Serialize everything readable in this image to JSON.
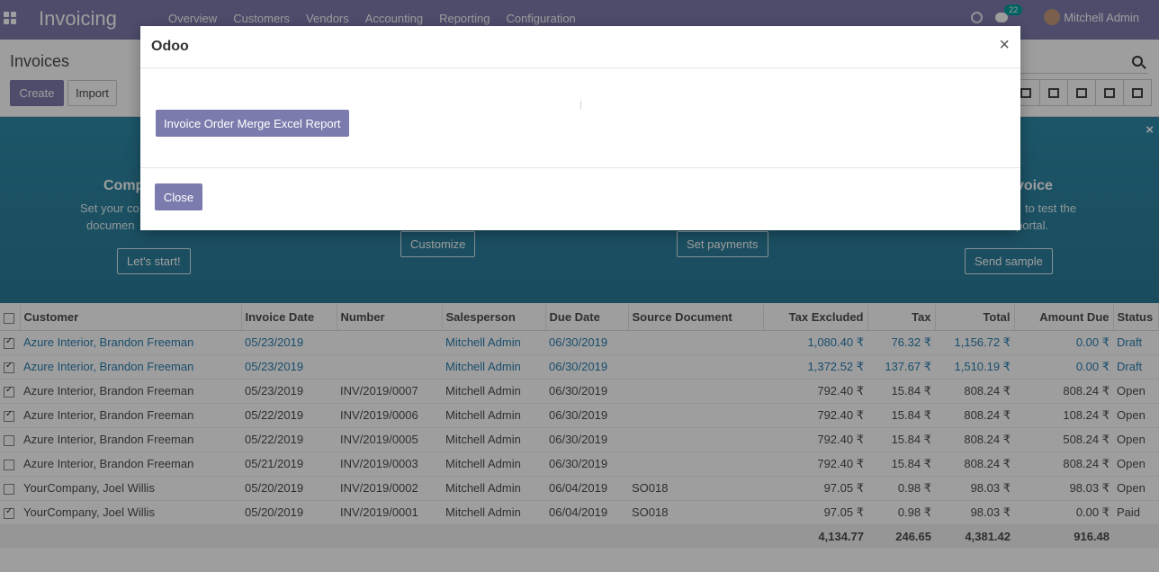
{
  "navbar": {
    "app_name": "Invoicing",
    "menu": [
      "Overview",
      "Customers",
      "Vendors",
      "Accounting",
      "Reporting",
      "Configuration"
    ],
    "chat_count": "22",
    "user": "Mitchell Admin"
  },
  "control_panel": {
    "title": "Invoices",
    "create_label": "Create",
    "import_label": "Import"
  },
  "banner": {
    "steps": [
      {
        "title": "Comp",
        "desc": [
          "Set your co",
          "documen"
        ],
        "button": "Let's start!"
      },
      {
        "title": "",
        "desc": [],
        "button": "Customize"
      },
      {
        "title": "",
        "desc": [],
        "button": "Set payments"
      },
      {
        "title": "voice",
        "desc": [
          "to test the",
          "portal."
        ],
        "button": "Send sample"
      }
    ]
  },
  "table": {
    "headers": [
      "Customer",
      "Invoice Date",
      "Number",
      "Salesperson",
      "Due Date",
      "Source Document",
      "Tax Excluded",
      "Tax",
      "Total",
      "Amount Due",
      "Status"
    ],
    "rows": [
      {
        "checked": true,
        "draft": true,
        "customer": "Azure Interior, Brandon Freeman",
        "date": "05/23/2019",
        "number": "",
        "salesperson": "Mitchell Admin",
        "due": "06/30/2019",
        "source": "",
        "tax_excl": "1,080.40 ₹",
        "tax": "76.32 ₹",
        "total": "1,156.72 ₹",
        "due_amt": "0.00 ₹",
        "status": "Draft"
      },
      {
        "checked": true,
        "draft": true,
        "customer": "Azure Interior, Brandon Freeman",
        "date": "05/23/2019",
        "number": "",
        "salesperson": "Mitchell Admin",
        "due": "06/30/2019",
        "source": "",
        "tax_excl": "1,372.52 ₹",
        "tax": "137.67 ₹",
        "total": "1,510.19 ₹",
        "due_amt": "0.00 ₹",
        "status": "Draft"
      },
      {
        "checked": true,
        "draft": false,
        "customer": "Azure Interior, Brandon Freeman",
        "date": "05/23/2019",
        "number": "INV/2019/0007",
        "salesperson": "Mitchell Admin",
        "due": "06/30/2019",
        "source": "",
        "tax_excl": "792.40 ₹",
        "tax": "15.84 ₹",
        "total": "808.24 ₹",
        "due_amt": "808.24 ₹",
        "status": "Open"
      },
      {
        "checked": true,
        "draft": false,
        "customer": "Azure Interior, Brandon Freeman",
        "date": "05/22/2019",
        "number": "INV/2019/0006",
        "salesperson": "Mitchell Admin",
        "due": "06/30/2019",
        "source": "",
        "tax_excl": "792.40 ₹",
        "tax": "15.84 ₹",
        "total": "808.24 ₹",
        "due_amt": "108.24 ₹",
        "status": "Open"
      },
      {
        "checked": false,
        "draft": false,
        "customer": "Azure Interior, Brandon Freeman",
        "date": "05/22/2019",
        "number": "INV/2019/0005",
        "salesperson": "Mitchell Admin",
        "due": "06/30/2019",
        "source": "",
        "tax_excl": "792.40 ₹",
        "tax": "15.84 ₹",
        "total": "808.24 ₹",
        "due_amt": "508.24 ₹",
        "status": "Open"
      },
      {
        "checked": false,
        "draft": false,
        "customer": "Azure Interior, Brandon Freeman",
        "date": "05/21/2019",
        "number": "INV/2019/0003",
        "salesperson": "Mitchell Admin",
        "due": "06/30/2019",
        "source": "",
        "tax_excl": "792.40 ₹",
        "tax": "15.84 ₹",
        "total": "808.24 ₹",
        "due_amt": "808.24 ₹",
        "status": "Open"
      },
      {
        "checked": false,
        "draft": false,
        "customer": "YourCompany, Joel Willis",
        "date": "05/20/2019",
        "number": "INV/2019/0002",
        "salesperson": "Mitchell Admin",
        "due": "06/04/2019",
        "source": "SO018",
        "tax_excl": "97.05 ₹",
        "tax": "0.98 ₹",
        "total": "98.03 ₹",
        "due_amt": "98.03 ₹",
        "status": "Open"
      },
      {
        "checked": true,
        "draft": false,
        "customer": "YourCompany, Joel Willis",
        "date": "05/20/2019",
        "number": "INV/2019/0001",
        "salesperson": "Mitchell Admin",
        "due": "06/04/2019",
        "source": "SO018",
        "tax_excl": "97.05 ₹",
        "tax": "0.98 ₹",
        "total": "98.03 ₹",
        "due_amt": "0.00 ₹",
        "status": "Paid"
      }
    ],
    "totals": {
      "tax_excl": "4,134.77",
      "tax": "246.65",
      "total": "4,381.42",
      "due_amt": "916.48"
    }
  },
  "modal": {
    "title": "Odoo",
    "close_glyph": "×",
    "report_button": "Invoice Order Merge Excel Report",
    "close_button": "Close"
  }
}
